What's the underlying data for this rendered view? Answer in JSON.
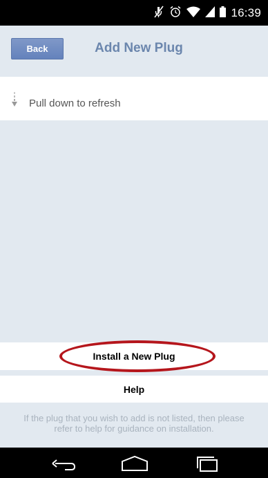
{
  "status_bar": {
    "time": "16:39",
    "icons": [
      "mute-icon",
      "alarm-icon",
      "wifi-icon",
      "signal-icon",
      "battery-icon"
    ]
  },
  "header": {
    "back_label": "Back",
    "title": "Add New Plug"
  },
  "refresh": {
    "label": "Pull down to refresh",
    "icon": "down-arrow-icon"
  },
  "actions": {
    "install_label": "Install a New Plug",
    "help_label": "Help",
    "help_note": "If the plug that you wish to add is not listed, then please refer to help for guidance on installation."
  },
  "nav_bar": {
    "icons": [
      "back-nav-icon",
      "home-nav-icon",
      "recents-nav-icon"
    ]
  },
  "colors": {
    "background": "#e2e9f0",
    "title": "#6b86ad",
    "back_button": "#6c88c0",
    "highlight": "#b5161c"
  }
}
